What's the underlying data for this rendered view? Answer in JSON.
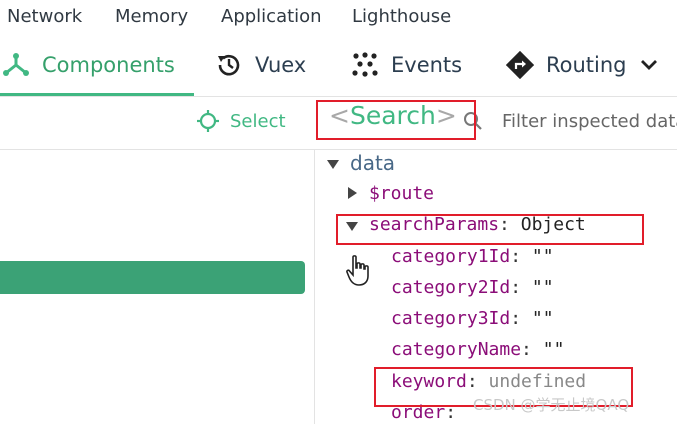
{
  "devtools_tabs": [
    "Network",
    "Memory",
    "Application",
    "Lighthouse"
  ],
  "nav": {
    "items": [
      {
        "label": "Components",
        "icon": "components-icon",
        "active": true
      },
      {
        "label": "Vuex",
        "icon": "history-icon",
        "active": false
      },
      {
        "label": "Events",
        "icon": "events-icon",
        "active": false
      },
      {
        "label": "Routing",
        "icon": "routing-icon",
        "active": false
      }
    ],
    "more_icon": "chevron-down-icon"
  },
  "toolbar": {
    "select_label": "Select",
    "search_left": "<",
    "search_word": "Search",
    "search_right": ">",
    "filter_placeholder": "Filter inspected data"
  },
  "inspector": {
    "section": "data",
    "route_key": "$route",
    "search_params_key": "searchParams",
    "search_params_value": "Object",
    "fields": [
      {
        "key": "category1Id",
        "value": "\"\""
      },
      {
        "key": "category2Id",
        "value": "\"\""
      },
      {
        "key": "category3Id",
        "value": "\"\""
      },
      {
        "key": "categoryName",
        "value": "\"\""
      },
      {
        "key": "keyword",
        "value": "undefined"
      },
      {
        "key": "order",
        "value": ""
      }
    ]
  },
  "watermark": "CSDN @学无止境QAQ",
  "colors": {
    "vue_green": "#41b883",
    "selected_row": "#3ba276",
    "annotation_red": "#e11d2a",
    "key_purple": "#8b0d78"
  }
}
